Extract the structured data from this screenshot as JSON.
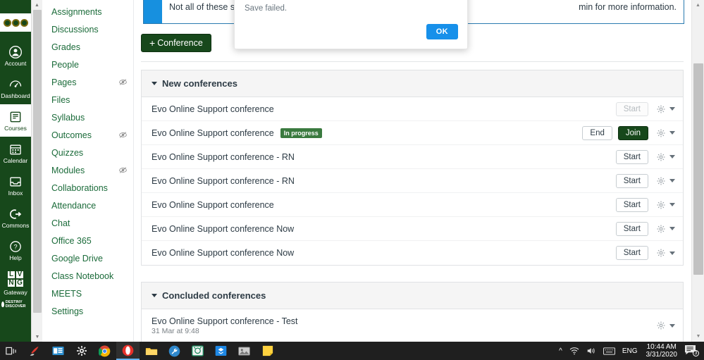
{
  "global_nav": {
    "logo_alt": "school-logo",
    "items": [
      {
        "label": "Account",
        "icon": "account-icon",
        "active": false
      },
      {
        "label": "Dashboard",
        "icon": "dashboard-icon",
        "active": false
      },
      {
        "label": "Courses",
        "icon": "courses-icon",
        "active": true
      },
      {
        "label": "Calendar",
        "icon": "calendar-icon",
        "active": false
      },
      {
        "label": "Inbox",
        "icon": "inbox-icon",
        "active": false
      },
      {
        "label": "Commons",
        "icon": "commons-icon",
        "active": false
      },
      {
        "label": "Help",
        "icon": "help-icon",
        "active": false
      },
      {
        "label": "Gateway",
        "icon": "lvng-gateway-logo",
        "active": false
      }
    ],
    "gateway_letters": [
      "L",
      "V",
      "N",
      "G"
    ],
    "destiny_label": "DESTINY DISCOVER"
  },
  "course_nav": {
    "items": [
      {
        "label": "Assignments",
        "hidden_from_students": false
      },
      {
        "label": "Discussions",
        "hidden_from_students": false
      },
      {
        "label": "Grades",
        "hidden_from_students": false
      },
      {
        "label": "People",
        "hidden_from_students": false
      },
      {
        "label": "Pages",
        "hidden_from_students": true
      },
      {
        "label": "Files",
        "hidden_from_students": false
      },
      {
        "label": "Syllabus",
        "hidden_from_students": false
      },
      {
        "label": "Outcomes",
        "hidden_from_students": true
      },
      {
        "label": "Quizzes",
        "hidden_from_students": false
      },
      {
        "label": "Modules",
        "hidden_from_students": true
      },
      {
        "label": "Collaborations",
        "hidden_from_students": false
      },
      {
        "label": "Attendance",
        "hidden_from_students": false
      },
      {
        "label": "Chat",
        "hidden_from_students": false
      },
      {
        "label": "Office 365",
        "hidden_from_students": false
      },
      {
        "label": "Google Drive",
        "hidden_from_students": false
      },
      {
        "label": "Class Notebook",
        "hidden_from_students": false
      },
      {
        "label": "MEETS",
        "hidden_from_students": false
      },
      {
        "label": "Settings",
        "hidden_from_students": false
      }
    ]
  },
  "alert": {
    "text_left": "Not all of these serv",
    "text_right": "min for more information.",
    "icon": "info-icon",
    "accent_color": "#1790df"
  },
  "modal": {
    "title": "",
    "message": "Save failed.",
    "ok_label": "OK",
    "ok_color": "#1790ea"
  },
  "toolbar": {
    "conference_label": "Conference",
    "plus_glyph": "+",
    "button_color": "#17481b"
  },
  "new_conferences": {
    "header": "New conferences",
    "rows": [
      {
        "name": "Evo Online Support conference",
        "badge": "",
        "primary_label": "Start",
        "primary_state": "disabled",
        "secondary_label": ""
      },
      {
        "name": "Evo Online Support conference",
        "badge": "In progress",
        "primary_label": "Join",
        "primary_state": "primary",
        "secondary_label": "End"
      },
      {
        "name": "Evo Online Support conference - RN",
        "badge": "",
        "primary_label": "Start",
        "primary_state": "normal",
        "secondary_label": ""
      },
      {
        "name": "Evo Online Support conference - RN",
        "badge": "",
        "primary_label": "Start",
        "primary_state": "normal",
        "secondary_label": ""
      },
      {
        "name": "Evo Online Support conference",
        "badge": "",
        "primary_label": "Start",
        "primary_state": "normal",
        "secondary_label": ""
      },
      {
        "name": "Evo Online Support conference Now",
        "badge": "",
        "primary_label": "Start",
        "primary_state": "normal",
        "secondary_label": ""
      },
      {
        "name": "Evo Online Support conference Now",
        "badge": "",
        "primary_label": "Start",
        "primary_state": "normal",
        "secondary_label": ""
      }
    ]
  },
  "concluded_conferences": {
    "header": "Concluded conferences",
    "rows": [
      {
        "name": "Evo Online Support conference - Test",
        "meta": "31 Mar at 9:48"
      }
    ]
  },
  "taskbar": {
    "icons": [
      {
        "name": "task-view-icon",
        "active": false
      },
      {
        "name": "ccleaner-icon",
        "active": false
      },
      {
        "name": "media-app-icon",
        "active": false
      },
      {
        "name": "settings-gear-icon",
        "active": false
      },
      {
        "name": "chrome-icon",
        "active": false
      },
      {
        "name": "opera-icon",
        "active": true
      },
      {
        "name": "file-explorer-icon",
        "active": false
      },
      {
        "name": "tools-icon",
        "active": false
      },
      {
        "name": "green-app-icon",
        "active": false
      },
      {
        "name": "dropbox-icon",
        "active": false
      },
      {
        "name": "photo-app-icon",
        "active": false
      },
      {
        "name": "sticky-notes-icon",
        "active": false
      }
    ],
    "tray": {
      "chevron": "^",
      "language": "ENG",
      "time": "10:44 AM",
      "date": "3/31/2020",
      "notification_count": "3"
    }
  }
}
